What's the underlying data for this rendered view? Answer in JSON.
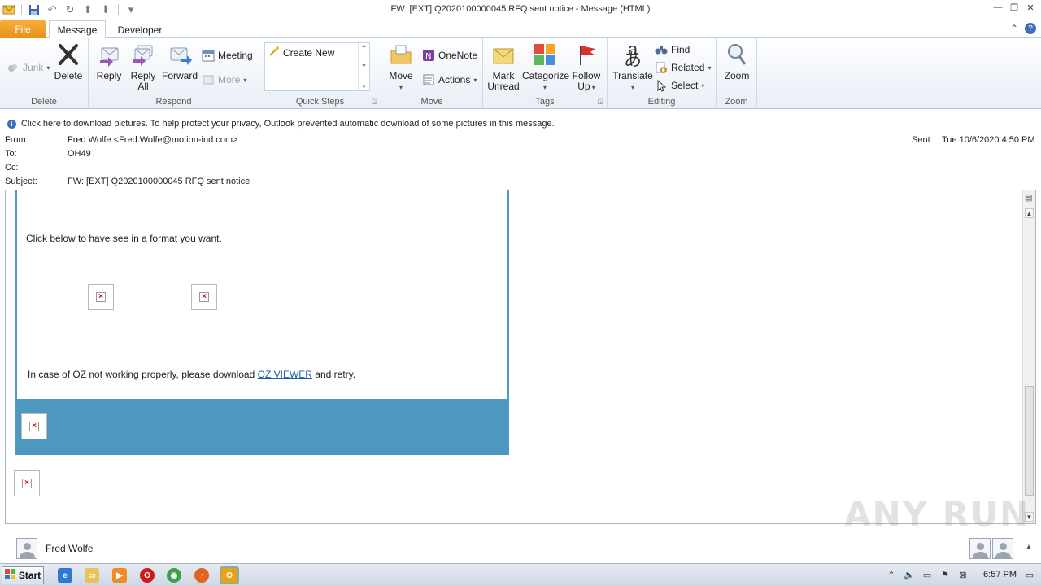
{
  "window": {
    "title": "FW: [EXT] Q2020100000045 RFQ sent notice  -  Message (HTML)"
  },
  "tabs": {
    "file": "File",
    "message": "Message",
    "developer": "Developer"
  },
  "ribbon": {
    "delete_group": {
      "label": "Delete",
      "junk": "Junk",
      "delete": "Delete"
    },
    "respond_group": {
      "label": "Respond",
      "reply": "Reply",
      "reply_all_1": "Reply",
      "reply_all_2": "All",
      "forward": "Forward",
      "meeting": "Meeting",
      "more": "More"
    },
    "quicksteps_group": {
      "label": "Quick Steps",
      "create_new": "Create New"
    },
    "move_group": {
      "label": "Move",
      "move": "Move",
      "onenote": "OneNote",
      "actions": "Actions"
    },
    "tags_group": {
      "label": "Tags",
      "mark_unread_1": "Mark",
      "mark_unread_2": "Unread",
      "categorize": "Categorize",
      "follow_up_1": "Follow",
      "follow_up_2": "Up"
    },
    "editing_group": {
      "label": "Editing",
      "translate": "Translate",
      "find": "Find",
      "related": "Related",
      "select": "Select"
    },
    "zoom_group": {
      "label": "Zoom",
      "zoom": "Zoom"
    }
  },
  "infobar": {
    "text": "Click here to download pictures. To help protect your privacy, Outlook prevented automatic download of some pictures in this message."
  },
  "headers": {
    "from_label": "From:",
    "from_value": "Fred Wolfe <Fred.Wolfe@motion-ind.com>",
    "to_label": "To:",
    "to_value": "OH49",
    "cc_label": "Cc:",
    "subject_label": "Subject:",
    "subject_value": "FW: [EXT] Q2020100000045 RFQ sent notice",
    "sent_label": "Sent:",
    "sent_value": "Tue 10/6/2020 4:50 PM"
  },
  "body": {
    "line1": "Click below to have see in a format you want.",
    "line2_prefix": "In case of OZ not working properly, please download ",
    "line2_link": "OZ VIEWER",
    "line2_suffix": " and retry."
  },
  "people_pane": {
    "name": "Fred Wolfe"
  },
  "taskbar": {
    "start": "Start",
    "clock": "6:57 PM"
  },
  "watermark": "ANY RUN"
}
